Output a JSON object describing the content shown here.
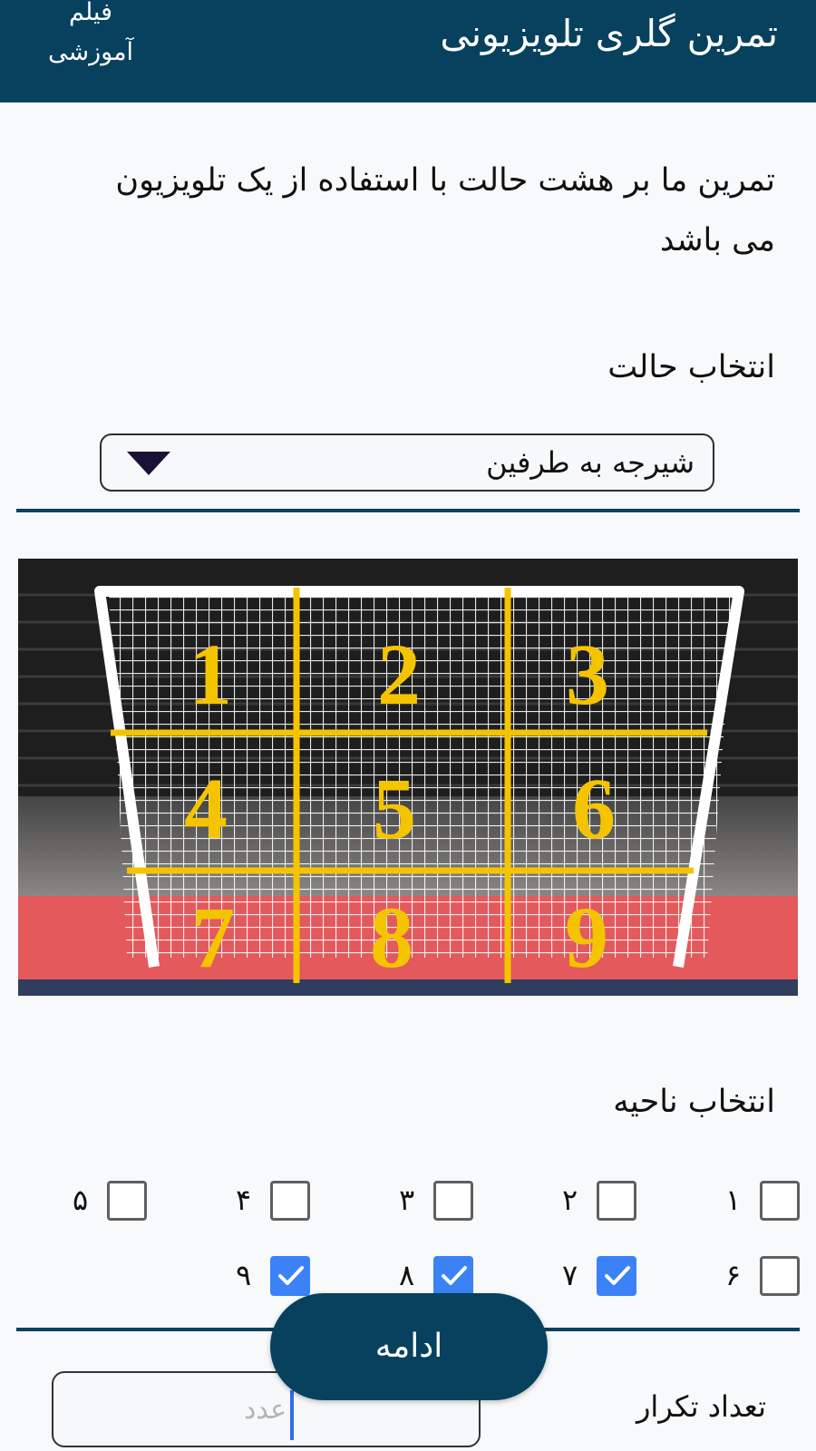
{
  "appbar": {
    "title": "تمرین گلری تلویزیونی",
    "action_line1": "فیلم",
    "action_line2": "آموزشی"
  },
  "intro_text": "تمرین ما بر هشت حالت با استفاده از یک تلویزیون می باشد",
  "mode_select": {
    "label": "انتخاب حالت",
    "selected_value": "شیرجه به طرفین"
  },
  "goal_image": {
    "zone_numbers": [
      "1",
      "2",
      "3",
      "4",
      "5",
      "6",
      "7",
      "8",
      "9"
    ],
    "colors": {
      "grid_lines": "#f5c400",
      "floor_stripe": "#e4595c",
      "net": "#ffffff"
    }
  },
  "zone_select": {
    "label": "انتخاب ناحیه",
    "zones": [
      {
        "label": "۱",
        "checked": false
      },
      {
        "label": "۲",
        "checked": false
      },
      {
        "label": "۳",
        "checked": false
      },
      {
        "label": "۴",
        "checked": false
      },
      {
        "label": "۵",
        "checked": false
      },
      {
        "label": "۶",
        "checked": false
      },
      {
        "label": "۷",
        "checked": true
      },
      {
        "label": "۸",
        "checked": true
      },
      {
        "label": "۹",
        "checked": true
      }
    ]
  },
  "repeat": {
    "label": "تعداد تکرار",
    "placeholder": "عدد",
    "value": ""
  },
  "continue_button": {
    "label": "ادامه"
  },
  "colors": {
    "primary": "#07415e",
    "checkbox_checked": "#3b82f6",
    "background": "#f8f9fb"
  }
}
